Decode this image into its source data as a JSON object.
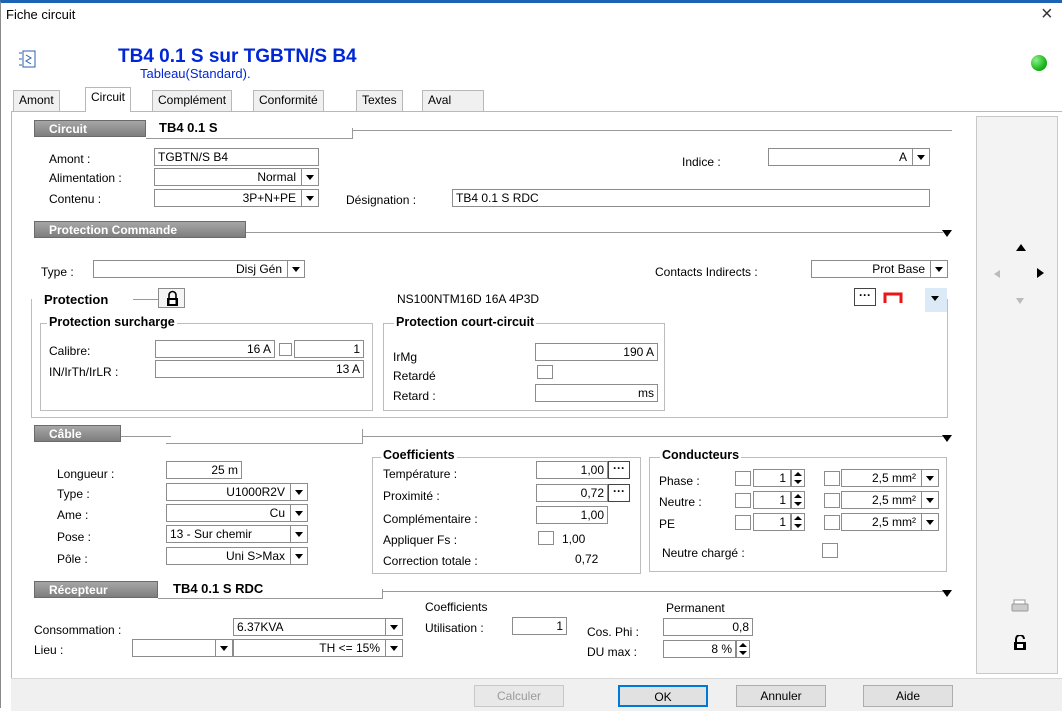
{
  "window": {
    "title": "Fiche circuit",
    "close": "×"
  },
  "header": {
    "title": "TB4 0.1 S sur TGBTN/S B4",
    "subtitle": "Tableau(Standard)."
  },
  "tabs": [
    "Amont",
    "Circuit",
    "Complément",
    "Conformité",
    "Textes",
    "Aval"
  ],
  "circuit": {
    "header": "Circuit",
    "name": "TB4 0.1 S",
    "amont_label": "Amont :",
    "amont": "TGBTN/S B4",
    "alimentation_label": "Alimentation :",
    "alimentation": "Normal",
    "contenu_label": "Contenu :",
    "contenu": "3P+N+PE",
    "indice_label": "Indice :",
    "indice": "A",
    "designation_label": "Désignation :",
    "designation": "TB4 0.1 S RDC"
  },
  "protection_commande": {
    "header": "Protection Commande",
    "type_label": "Type :",
    "type": "Disj Gén",
    "contacts_label": "Contacts Indirects :",
    "contacts": "Prot Base",
    "protection_label": "Protection",
    "protection_ref": "NS100NTM16D   16A 4P3D",
    "more": "···",
    "surcharge": {
      "title": "Protection surcharge",
      "calibre_label": "Calibre:",
      "calibre": "16 A",
      "calibre2": "1",
      "in_label": "IN/IrTh/IrLR :",
      "in": "13 A"
    },
    "court_circuit": {
      "title": "Protection court-circuit",
      "irmg_label": "IrMg",
      "irmg": "190 A",
      "retarde_label": "Retardé",
      "retard_label": "Retard :",
      "retard": "ms"
    }
  },
  "cable": {
    "header": "Câble",
    "longueur_label": "Longueur :",
    "longueur": "25 m",
    "type_label": "Type :",
    "type": "U1000R2V",
    "ame_label": "Ame :",
    "ame": "Cu",
    "pose_label": "Pose :",
    "pose": "13 - Sur chemir",
    "pole_label": "Pôle :",
    "pole": "Uni S>Max",
    "coefficients": {
      "title": "Coefficients",
      "temperature_label": "Température :",
      "temperature": "1,00",
      "proximite_label": "Proximité :",
      "proximite": "0,72",
      "complementaire_label": "Complémentaire :",
      "complementaire": "1,00",
      "fs_label": "Appliquer Fs :",
      "fs": "1,00",
      "correction_label": "Correction totale :",
      "correction": "0,72"
    },
    "conducteurs": {
      "title": "Conducteurs",
      "rows": [
        {
          "label": "Phase :",
          "count": "1",
          "section": "2,5 mm²"
        },
        {
          "label": "Neutre :",
          "count": "1",
          "section": "2,5 mm²"
        },
        {
          "label": "PE",
          "count": "1",
          "section": "2,5 mm²"
        }
      ],
      "neutre_charge_label": "Neutre chargé :"
    }
  },
  "recepteur": {
    "header": "Récepteur",
    "name": "TB4 0.1 S RDC",
    "coefficients_label": "Coefficients",
    "permanent_label": "Permanent",
    "consommation_label": "Consommation :",
    "consommation": "6.37KVA",
    "utilisation_label": "Utilisation :",
    "utilisation": "1",
    "cosphi_label": "Cos. Phi :",
    "cosphi": "0,8",
    "lieu_label": "Lieu :",
    "lieu": "",
    "th": "TH <= 15%",
    "dumax_label": "DU max :",
    "dumax": "8 %"
  },
  "buttons": {
    "calculer": "Calculer",
    "ok": "OK",
    "annuler": "Annuler",
    "aide": "Aide"
  },
  "colors": {
    "accent": "#0026d6",
    "title_bar": "#1c62b5",
    "status_green": "#1db81d"
  }
}
